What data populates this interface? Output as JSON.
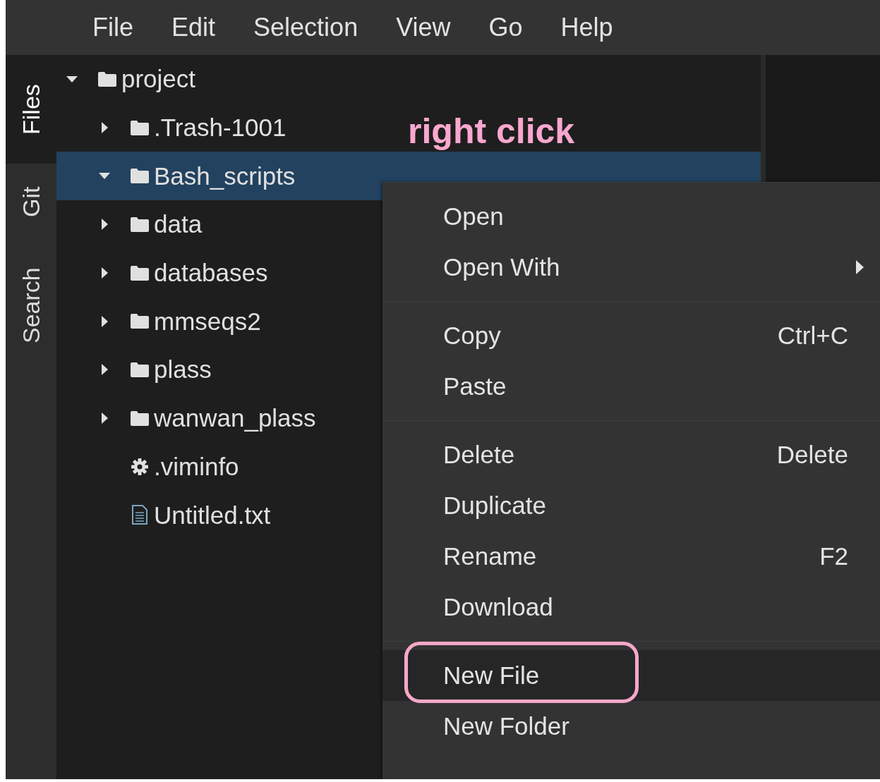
{
  "menubar": [
    {
      "label": "File"
    },
    {
      "label": "Edit"
    },
    {
      "label": "Selection"
    },
    {
      "label": "View"
    },
    {
      "label": "Go"
    },
    {
      "label": "Help"
    }
  ],
  "activity_tabs": [
    {
      "label": "Files",
      "selected": true
    },
    {
      "label": "Git",
      "selected": false
    },
    {
      "label": "Search",
      "selected": false
    }
  ],
  "tree": [
    {
      "label": "project",
      "kind": "folder",
      "expanded": true,
      "selected": false,
      "children": [
        {
          "label": ".Trash-1001",
          "kind": "folder",
          "expanded": false,
          "selected": false
        },
        {
          "label": "Bash_scripts",
          "kind": "folder",
          "expanded": true,
          "selected": true
        },
        {
          "label": "data",
          "kind": "folder",
          "expanded": false,
          "selected": false
        },
        {
          "label": "databases",
          "kind": "folder",
          "expanded": false,
          "selected": false
        },
        {
          "label": "mmseqs2",
          "kind": "folder",
          "expanded": false,
          "selected": false
        },
        {
          "label": "plass",
          "kind": "folder",
          "expanded": false,
          "selected": false
        },
        {
          "label": "wanwan_plass",
          "kind": "folder",
          "expanded": false,
          "selected": false
        },
        {
          "label": ".viminfo",
          "kind": "config",
          "selected": false
        },
        {
          "label": "Untitled.txt",
          "kind": "text",
          "selected": false
        }
      ]
    }
  ],
  "context_menu": {
    "groups": [
      [
        {
          "label": "Open",
          "highlighted": false,
          "circled": false
        },
        {
          "label": "Open With",
          "submenu": true,
          "highlighted": false,
          "circled": false
        }
      ],
      [
        {
          "label": "Copy",
          "shortcut": "Ctrl+C",
          "highlighted": false,
          "circled": false
        },
        {
          "label": "Paste",
          "highlighted": false,
          "circled": false
        }
      ],
      [
        {
          "label": "Delete",
          "shortcut": "Delete",
          "highlighted": false,
          "circled": false
        },
        {
          "label": "Duplicate",
          "highlighted": false,
          "circled": false
        },
        {
          "label": "Rename",
          "shortcut": "F2",
          "highlighted": false,
          "circled": false
        },
        {
          "label": "Download",
          "highlighted": false,
          "circled": false
        }
      ],
      [
        {
          "label": "New File",
          "highlighted": true,
          "circled": true
        },
        {
          "label": "New Folder",
          "highlighted": false,
          "circled": false
        }
      ]
    ]
  },
  "annotation": {
    "label": "right click"
  }
}
